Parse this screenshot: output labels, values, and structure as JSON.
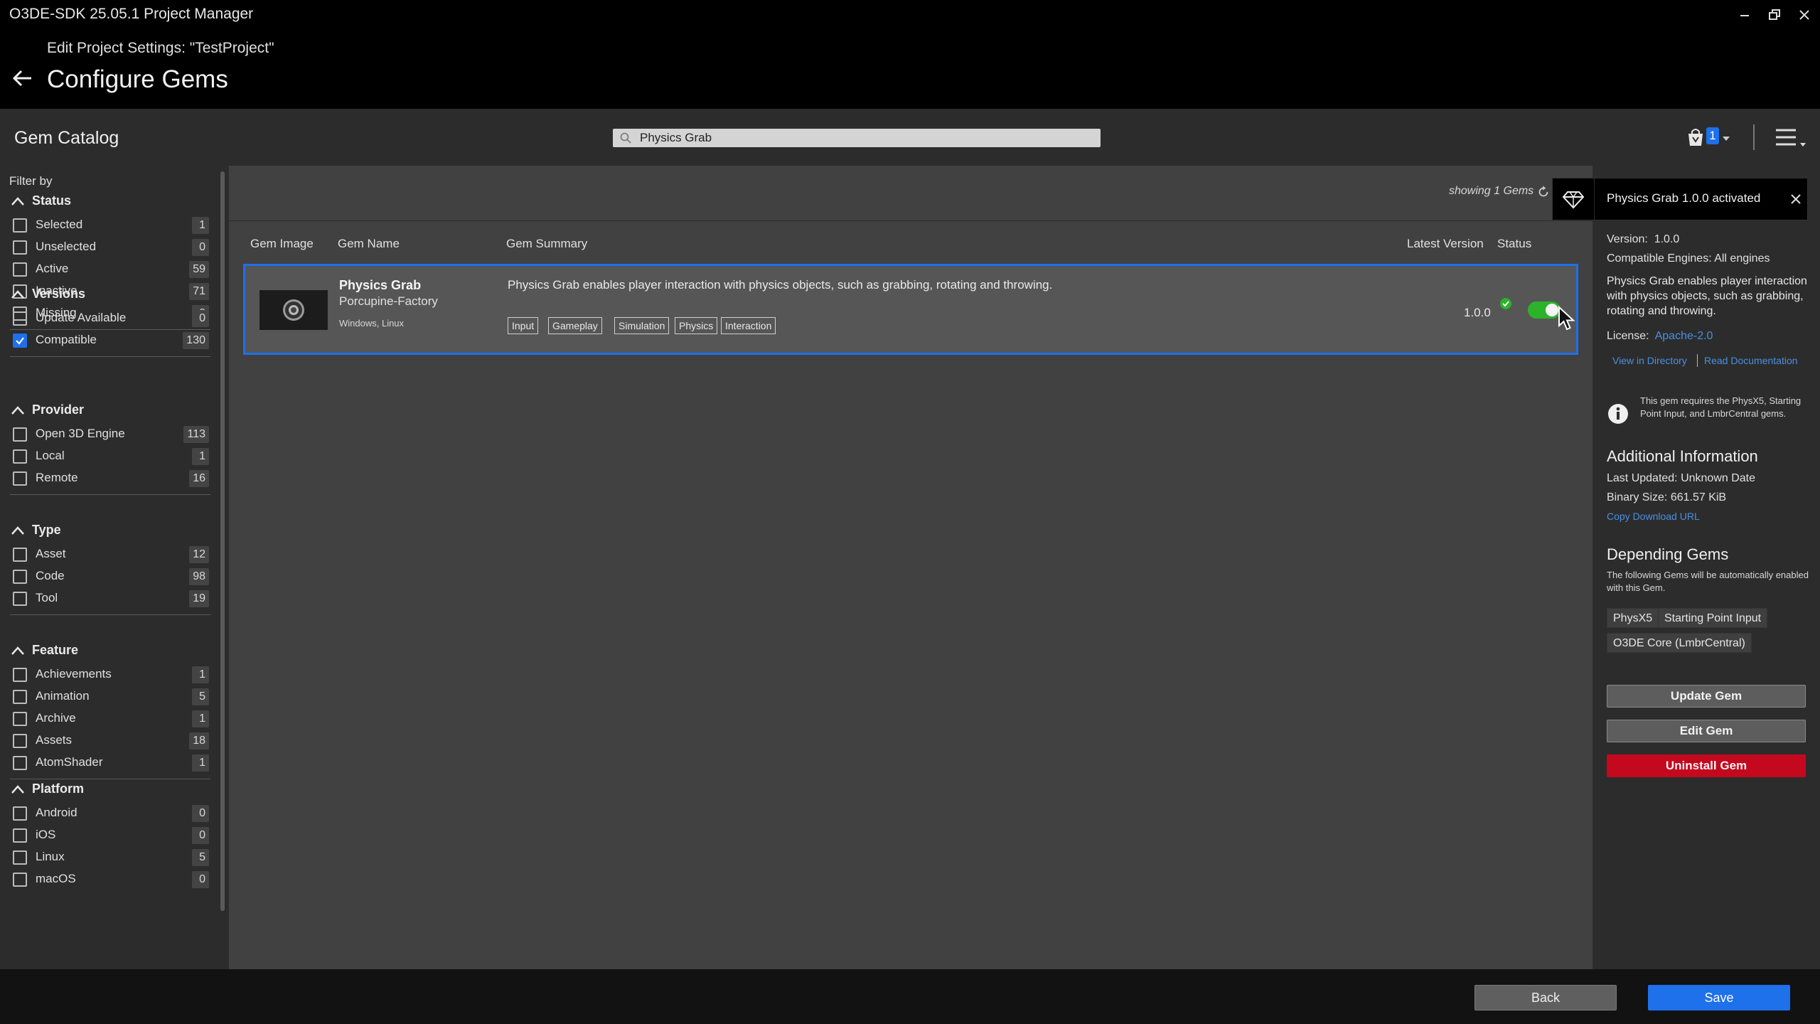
{
  "window": {
    "title": "O3DE-SDK 25.05.1 Project Manager"
  },
  "header": {
    "subtitle": "Edit Project Settings: \"TestProject\"",
    "title": "Configure Gems"
  },
  "catalog": {
    "title": "Gem Catalog",
    "search_value": "Physics Grab",
    "cart_count": "1"
  },
  "filter": {
    "title": "Filter by",
    "sections": [
      {
        "label": "Status",
        "items": [
          {
            "label": "Selected",
            "count": "1",
            "checked": false
          },
          {
            "label": "Unselected",
            "count": "0",
            "checked": false
          },
          {
            "label": "Active",
            "count": "59",
            "checked": false
          },
          {
            "label": "Inactive",
            "count": "71",
            "checked": false
          },
          {
            "label": "Missing",
            "count": "0",
            "checked": false
          }
        ]
      },
      {
        "label": "Versions",
        "items": [
          {
            "label": "Update Available",
            "count": "0",
            "checked": false
          },
          {
            "label": "Compatible",
            "count": "130",
            "checked": true
          }
        ]
      },
      {
        "label": "Provider",
        "items": [
          {
            "label": "Open 3D Engine",
            "count": "113",
            "checked": false
          },
          {
            "label": "Local",
            "count": "1",
            "checked": false
          },
          {
            "label": "Remote",
            "count": "16",
            "checked": false
          }
        ]
      },
      {
        "label": "Type",
        "items": [
          {
            "label": "Asset",
            "count": "12",
            "checked": false
          },
          {
            "label": "Code",
            "count": "98",
            "checked": false
          },
          {
            "label": "Tool",
            "count": "19",
            "checked": false
          }
        ]
      },
      {
        "label": "Feature",
        "items": [
          {
            "label": "Achievements",
            "count": "1",
            "checked": false
          },
          {
            "label": "Animation",
            "count": "5",
            "checked": false
          },
          {
            "label": "Archive",
            "count": "1",
            "checked": false
          },
          {
            "label": "Assets",
            "count": "18",
            "checked": false
          },
          {
            "label": "AtomShader",
            "count": "1",
            "checked": false
          }
        ]
      },
      {
        "label": "Platform",
        "items": [
          {
            "label": "Android",
            "count": "0",
            "checked": false
          },
          {
            "label": "iOS",
            "count": "0",
            "checked": false
          },
          {
            "label": "Linux",
            "count": "5",
            "checked": false
          },
          {
            "label": "macOS",
            "count": "0",
            "checked": false
          }
        ]
      }
    ]
  },
  "list": {
    "showing": "showing 1 Gems",
    "columns": {
      "image": "Gem Image",
      "name": "Gem Name",
      "summary": "Gem Summary",
      "version": "Latest Version",
      "status": "Status"
    },
    "gem": {
      "name": "Physics Grab",
      "creator": "Porcupine-Factory",
      "platforms": "Windows, Linux",
      "summary": "Physics Grab enables player interaction with physics objects, such as grabbing, rotating and throwing.",
      "tags": [
        "Input",
        "Gameplay",
        "Simulation",
        "Physics",
        "Interaction"
      ],
      "version": "1.0.0",
      "enabled": true
    }
  },
  "notification": {
    "text": "Physics Grab 1.0.0 activated"
  },
  "inspector": {
    "version_label": "Version:",
    "version_value": "1.0.0",
    "engines_label": "Compatible Engines:",
    "engines_value": "All engines",
    "summary": "Physics Grab enables player interaction with physics objects, such as grabbing, rotating and throwing.",
    "license_label": "License:",
    "license_value": "Apache-2.0",
    "view_directory": "View in Directory",
    "read_docs": "Read Documentation",
    "requirement": "This gem requires the PhysX5, Starting Point Input, and LmbrCentral gems.",
    "additional_heading": "Additional Information",
    "last_updated": "Last Updated: Unknown Date",
    "binary_size": "Binary Size:  661.57 KiB",
    "copy_url": "Copy Download URL",
    "depending_heading": "Depending Gems",
    "depending_desc": "The following Gems will be automatically enabled with this Gem.",
    "depending": [
      "PhysX5",
      "Starting Point Input",
      "O3DE Core (LmbrCentral)"
    ],
    "update_btn": "Update Gem",
    "edit_btn": "Edit Gem",
    "uninstall_btn": "Uninstall Gem"
  },
  "footer": {
    "back": "Back",
    "save": "Save"
  },
  "colors": {
    "accent": "#1e70eb",
    "toggle_on": "#2bb32b",
    "danger": "#c4081d",
    "link": "#4a90e2"
  }
}
